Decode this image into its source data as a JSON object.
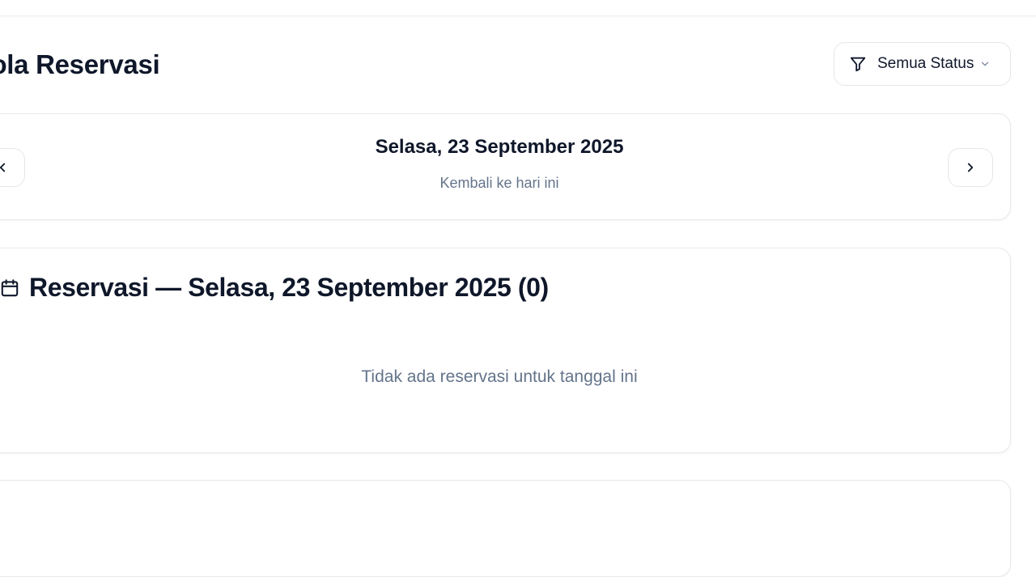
{
  "page": {
    "title": "Kelola Reservasi"
  },
  "filter": {
    "label": "Semua Status",
    "icon": "filter-icon",
    "dropdown_icon": "chevron-down-icon"
  },
  "date_nav": {
    "date": "Selasa, 23 September 2025",
    "today_link": "Kembali ke hari ini",
    "prev_icon": "chevron-left-icon",
    "next_icon": "chevron-right-icon"
  },
  "reservations": {
    "icon": "calendar-icon",
    "title": "Reservasi — Selasa, 23 September 2025 (0)",
    "count": 0,
    "empty_message": "Tidak ada reservasi untuk tanggal ini"
  },
  "colors": {
    "text_primary": "#0f172a",
    "text_muted": "#64748b",
    "border": "#e6e8ec",
    "background": "#ffffff"
  }
}
